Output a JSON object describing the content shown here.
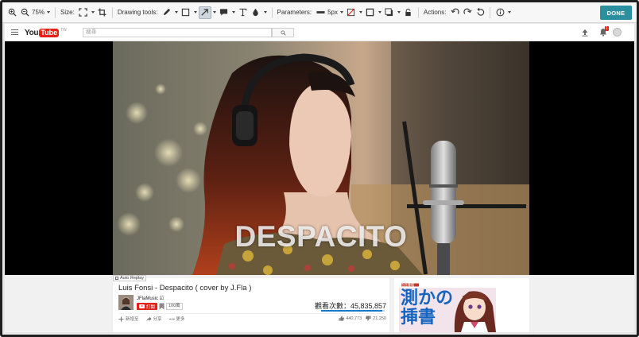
{
  "toolbar": {
    "zoom_value": "75%",
    "size_label": "Size:",
    "drawing_tools_label": "Drawing tools:",
    "parameters_label": "Parameters:",
    "stroke_width": "5px",
    "actions_label": "Actions:",
    "done_label": "DONE",
    "icons": [
      "zoom-in-icon",
      "zoom-out-icon",
      "resize-icon",
      "crop-icon",
      "pen-icon",
      "rectangle-icon",
      "arrow-icon",
      "callout-icon",
      "text-icon",
      "blur-icon",
      "line-width-icon",
      "no-fill-icon",
      "border-icon",
      "shadow-icon",
      "lock-icon",
      "undo-icon",
      "redo-icon",
      "reset-icon",
      "info-icon"
    ]
  },
  "youtube": {
    "logo_you": "You",
    "logo_tube": "Tube",
    "logo_region": "TW",
    "search_placeholder": "搜尋",
    "notification_count": "1"
  },
  "video": {
    "overlay_title": "DESPACITO",
    "auto_replay_label": "Auto Replay",
    "title": "Luis Fonsi - Despacito ( cover by J.Fla )",
    "channel_name": "JFlaMusic ☑",
    "subscribe_label": "訂閱",
    "subscriber_count": "100萬",
    "views": "觀看次數：45,835,857",
    "like_ratio": 0.96,
    "actions": {
      "add_label": "新增至",
      "share_label": "分享",
      "more_label": "更多"
    },
    "likes": "440,773",
    "dislikes": "21,250"
  },
  "ad": {
    "headline": "測かの挿書",
    "tag": "包含書籍"
  },
  "colors": {
    "done_button": "#2b8f9f",
    "youtube_red": "#e62117",
    "views_bar": "#167ac6"
  }
}
